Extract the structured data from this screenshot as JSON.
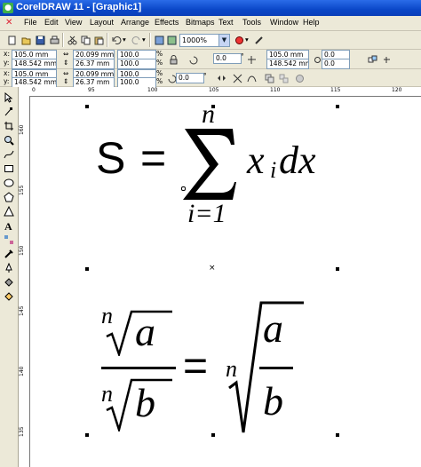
{
  "window": {
    "title": "CorelDRAW 11 - [Graphic1]"
  },
  "menu": [
    "File",
    "Edit",
    "View",
    "Layout",
    "Arrange",
    "Effects",
    "Bitmaps",
    "Text",
    "Tools",
    "Window",
    "Help"
  ],
  "toolbar": {
    "zoom": "1000%"
  },
  "property_bar": {
    "row1": {
      "x": "105.0 mm",
      "y": "148.542 mm",
      "width": "20.099 mm",
      "height": "26.37 mm",
      "scale_w": "100.0",
      "scale_h": "100.0",
      "angle": "0.0",
      "pos_x": "105.0 mm",
      "pos_y": "148.542 mm",
      "nudge_1": "0.0",
      "nudge_2": "0.0"
    },
    "row2": {
      "x": "105.0 mm",
      "y": "148.542 mm",
      "width": "20.099 mm",
      "height": "26.37 mm",
      "scale_w": "100.0",
      "scale_h": "100.0",
      "angle": "0.0"
    }
  },
  "rulers": {
    "horizontal": [
      "0",
      "95",
      "100",
      "105",
      "110",
      "115",
      "120"
    ],
    "vertical": [
      "160",
      "155",
      "150",
      "145",
      "140",
      "135"
    ]
  },
  "formula1": {
    "lhs": "S",
    "eq": "=",
    "sum_upper": "n",
    "sum_lower": "i=1",
    "term_x": "x",
    "term_i": "i",
    "term_dx": "dx"
  },
  "formula2": {
    "num_index": "n",
    "num_rad": "a",
    "den_index": "n",
    "den_rad": "b",
    "eq": "=",
    "rhs_index": "n",
    "rhs_num": "a",
    "rhs_den": "b"
  },
  "icons": {
    "select_tool": "pointer-icon",
    "shape_tool": "shape-icon",
    "zoom_tool": "zoom-icon"
  }
}
